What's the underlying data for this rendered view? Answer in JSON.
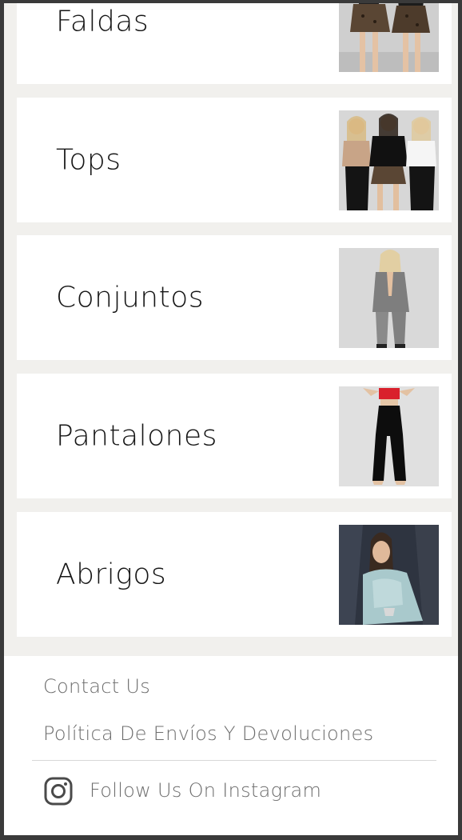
{
  "categories": [
    {
      "label": "Faldas",
      "image": "model-leopard-skirt-photo"
    },
    {
      "label": "Tops",
      "image": "three-models-tops-photo"
    },
    {
      "label": "Conjuntos",
      "image": "model-gray-suit-photo"
    },
    {
      "label": "Pantalones",
      "image": "model-black-pants-photo"
    },
    {
      "label": "Abrigos",
      "image": "model-fur-coat-photo"
    }
  ],
  "footer": {
    "contact": "Contact Us",
    "policy": "Política De Envíos Y Devoluciones",
    "instagram_label": "Follow Us On Instagram",
    "instagram_icon": "instagram-icon"
  },
  "colors": {
    "page_bg": "#f1f0ed",
    "card_bg": "#ffffff",
    "label_text": "#161616",
    "footer_text": "#6d6d6d"
  }
}
